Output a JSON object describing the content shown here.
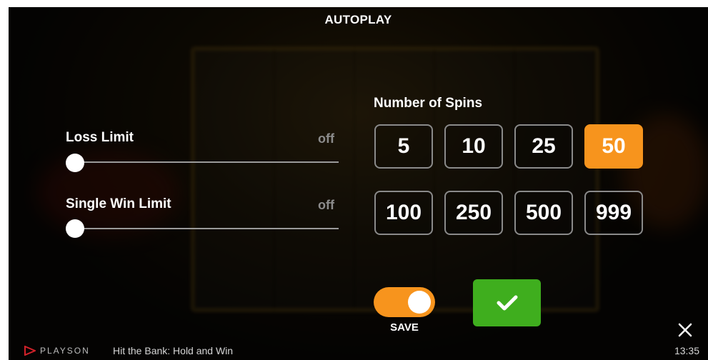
{
  "header": {
    "title": "AUTOPLAY"
  },
  "limits": [
    {
      "label": "Loss Limit",
      "value": "off",
      "level": 0
    },
    {
      "label": "Single Win Limit",
      "value": "off",
      "level": 0
    }
  ],
  "spins": {
    "label": "Number of Spins",
    "options": [
      "5",
      "10",
      "25",
      "50",
      "100",
      "250",
      "500",
      "999"
    ],
    "selected": "50"
  },
  "save": {
    "label": "SAVE",
    "enabled": true
  },
  "icons": {
    "confirm": "checkmark-icon",
    "close": "close-icon",
    "logo": "playson-logo-icon"
  },
  "colors": {
    "accent": "#f7941d",
    "confirm": "#3fae1e"
  },
  "footer": {
    "brand": "PLAYSON",
    "game_name": "Hit the Bank: Hold and Win",
    "time": "13:35"
  }
}
